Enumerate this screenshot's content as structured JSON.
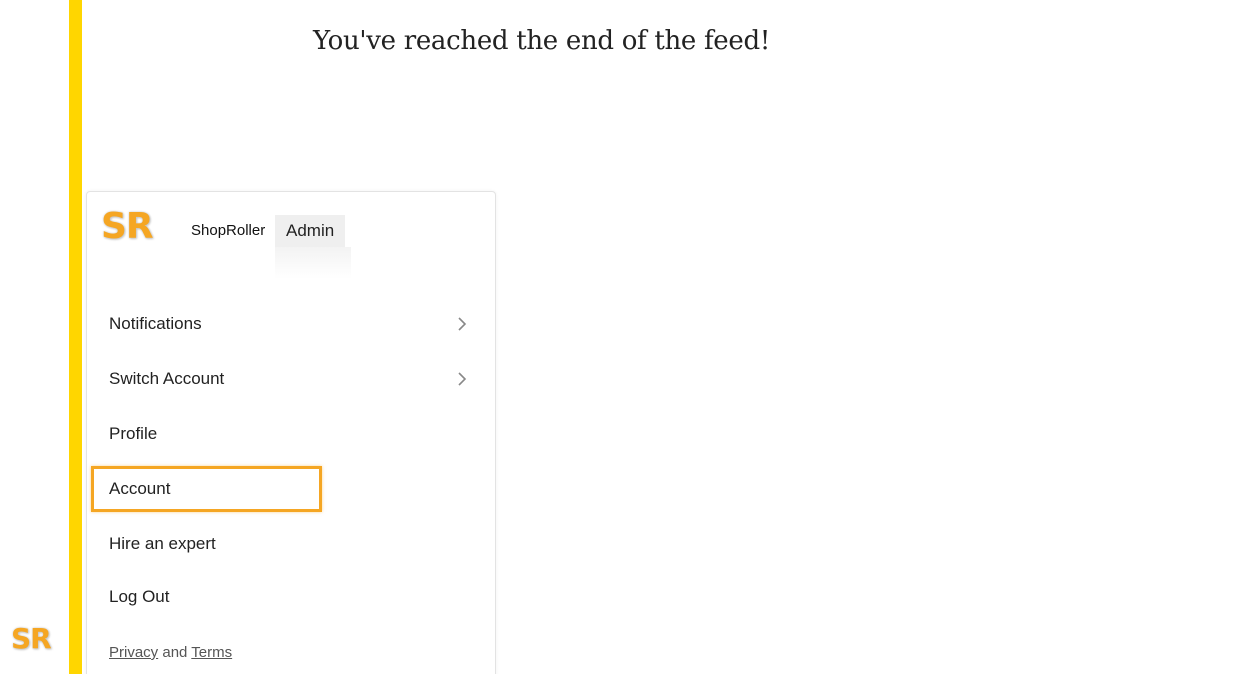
{
  "feed": {
    "end_message": "You've reached the end of the feed!"
  },
  "branding": {
    "logo_text": "SR",
    "shop_name": "ShopRoller",
    "role_badge": "Admin",
    "logo_color": "#F5A623",
    "sidebar_accent": "#FFD600"
  },
  "menu": {
    "items": [
      {
        "label": "Notifications",
        "icon": "chevron-right-icon"
      },
      {
        "label": "Switch Account",
        "icon": "chevron-right-icon"
      },
      {
        "label": "Profile"
      },
      {
        "label": "Account",
        "highlighted": true
      },
      {
        "label": "Hire an expert"
      },
      {
        "label": "Log Out"
      }
    ],
    "highlight_color": "#F5A623"
  },
  "footer": {
    "privacy_label": "Privacy",
    "and_text": "and",
    "terms_label": "Terms"
  }
}
